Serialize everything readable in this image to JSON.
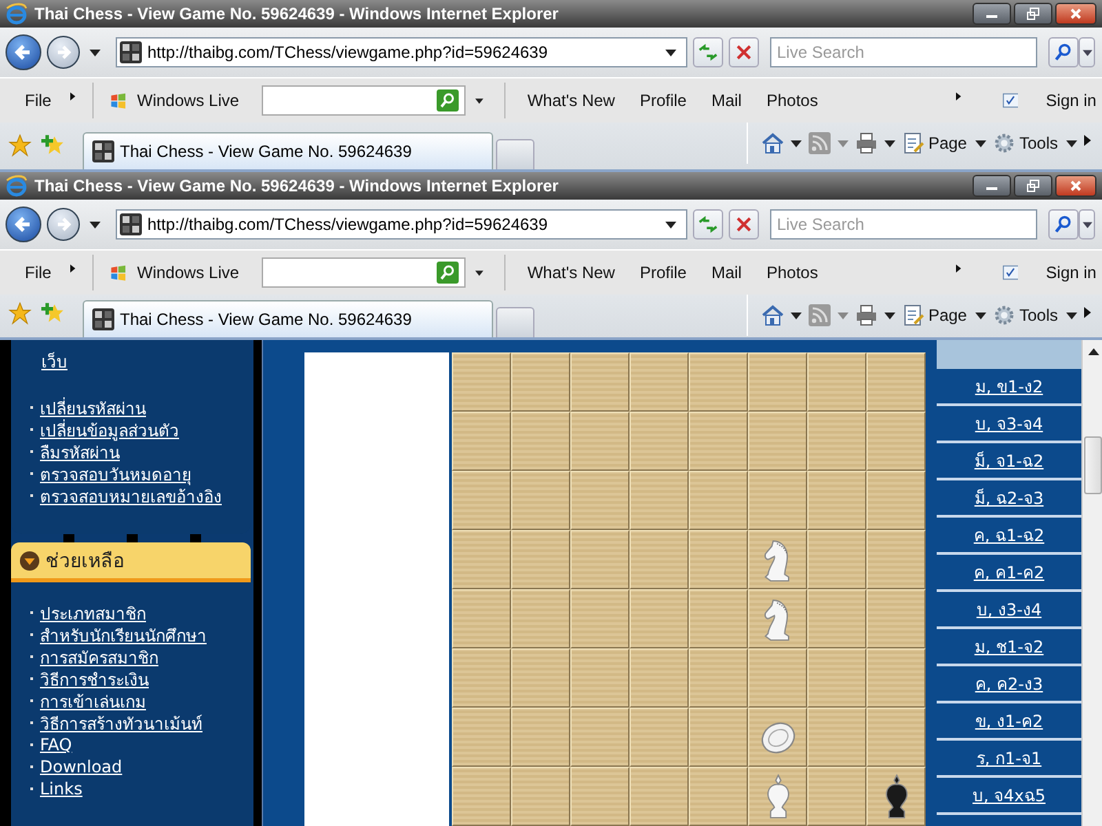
{
  "windows": [
    {
      "title": "Thai Chess - View Game No. 59624639 - Windows Internet Explorer",
      "address": "http://thaibg.com/TChess/viewgame.php?id=59624639",
      "search_placeholder": "Live Search",
      "menu": "File",
      "live_label": "Windows Live",
      "live_links": [
        "What's New",
        "Profile",
        "Mail",
        "Photos"
      ],
      "sign_in": "Sign in",
      "tab": "Thai Chess - View Game No. 59624639",
      "commands": [
        "Page",
        "Tools"
      ]
    },
    {
      "title": "Thai Chess - View Game No. 59624639 - Windows Internet Explorer",
      "address": "http://thaibg.com/TChess/viewgame.php?id=59624639",
      "search_placeholder": "Live Search",
      "menu": "File",
      "live_label": "Windows Live",
      "live_links": [
        "What's New",
        "Profile",
        "Mail",
        "Photos"
      ],
      "sign_in": "Sign in",
      "tab": "Thai Chess - View Game No. 59624639",
      "commands": [
        "Page",
        "Tools"
      ]
    }
  ],
  "sidebar": {
    "account_continuation": "เว็บ",
    "account_links": [
      "เปลี่ยนรหัสผ่าน",
      "เปลี่ยนข้อมูลส่วนตัว",
      "ลืมรหัสผ่าน",
      "ตรวจสอบวันหมดอายุ",
      "ตรวจสอบหมายเลขอ้างอิง"
    ],
    "help_title": "ช่วยเหลือ",
    "help_links": [
      "ประเภทสมาชิก",
      "สำหรับนักเรียนนักศึกษา",
      "การสมัครสมาชิก",
      "วิธีการชำระเงิน",
      "การเข้าเล่นเกม",
      "วิธีการสร้างทัวนาเม้นท์",
      "FAQ",
      "Download",
      "Links"
    ]
  },
  "board": {
    "rows": [
      [
        {
          "kind": "empty"
        },
        {
          "kind": "empty"
        },
        {
          "kind": "empty"
        },
        {
          "kind": "empty"
        },
        {
          "kind": "empty"
        },
        {
          "kind": "empty"
        },
        {
          "kind": "empty"
        },
        {
          "kind": "empty"
        }
      ],
      [
        {
          "kind": "empty"
        },
        {
          "kind": "empty"
        },
        {
          "kind": "empty"
        },
        {
          "kind": "empty"
        },
        {
          "kind": "empty"
        },
        {
          "kind": "empty"
        },
        {
          "kind": "empty"
        },
        {
          "kind": "empty"
        }
      ],
      [
        {
          "kind": "empty"
        },
        {
          "kind": "empty"
        },
        {
          "kind": "empty"
        },
        {
          "kind": "empty"
        },
        {
          "kind": "empty"
        },
        {
          "kind": "empty"
        },
        {
          "kind": "empty"
        },
        {
          "kind": "empty"
        }
      ],
      [
        {
          "kind": "empty"
        },
        {
          "kind": "empty"
        },
        {
          "kind": "empty"
        },
        {
          "kind": "empty"
        },
        {
          "kind": "empty"
        },
        {
          "kind": "knight",
          "black": false
        },
        {
          "kind": "empty"
        },
        {
          "kind": "empty"
        }
      ],
      [
        {
          "kind": "empty"
        },
        {
          "kind": "empty"
        },
        {
          "kind": "empty"
        },
        {
          "kind": "empty"
        },
        {
          "kind": "empty"
        },
        {
          "kind": "knight",
          "black": false
        },
        {
          "kind": "empty"
        },
        {
          "kind": "empty"
        }
      ],
      [
        {
          "kind": "empty"
        },
        {
          "kind": "empty"
        },
        {
          "kind": "empty"
        },
        {
          "kind": "empty"
        },
        {
          "kind": "empty"
        },
        {
          "kind": "empty"
        },
        {
          "kind": "empty"
        },
        {
          "kind": "empty"
        }
      ],
      [
        {
          "kind": "empty"
        },
        {
          "kind": "empty"
        },
        {
          "kind": "empty"
        },
        {
          "kind": "empty"
        },
        {
          "kind": "empty"
        },
        {
          "kind": "disc",
          "black": false
        },
        {
          "kind": "empty"
        },
        {
          "kind": "empty"
        }
      ],
      [
        {
          "kind": "empty"
        },
        {
          "kind": "empty"
        },
        {
          "kind": "empty"
        },
        {
          "kind": "empty"
        },
        {
          "kind": "empty"
        },
        {
          "kind": "crowned",
          "black": false
        },
        {
          "kind": "empty"
        },
        {
          "kind": "crowned",
          "black": true
        }
      ]
    ]
  },
  "moves": [
    "ม, ข1-ง2",
    "บ, จ3-จ4",
    "ม็, จ1-ฉ2",
    "ม็, ฉ2-จ3",
    "ค, ฉ1-ฉ2",
    "ค, ค1-ค2",
    "บ, ง3-ง4",
    "ม, ช1-จ2",
    "ค, ค2-ง3",
    "ข, ง1-ค2",
    "ร, ก1-จ1",
    "บ, จ4xฉ5"
  ]
}
